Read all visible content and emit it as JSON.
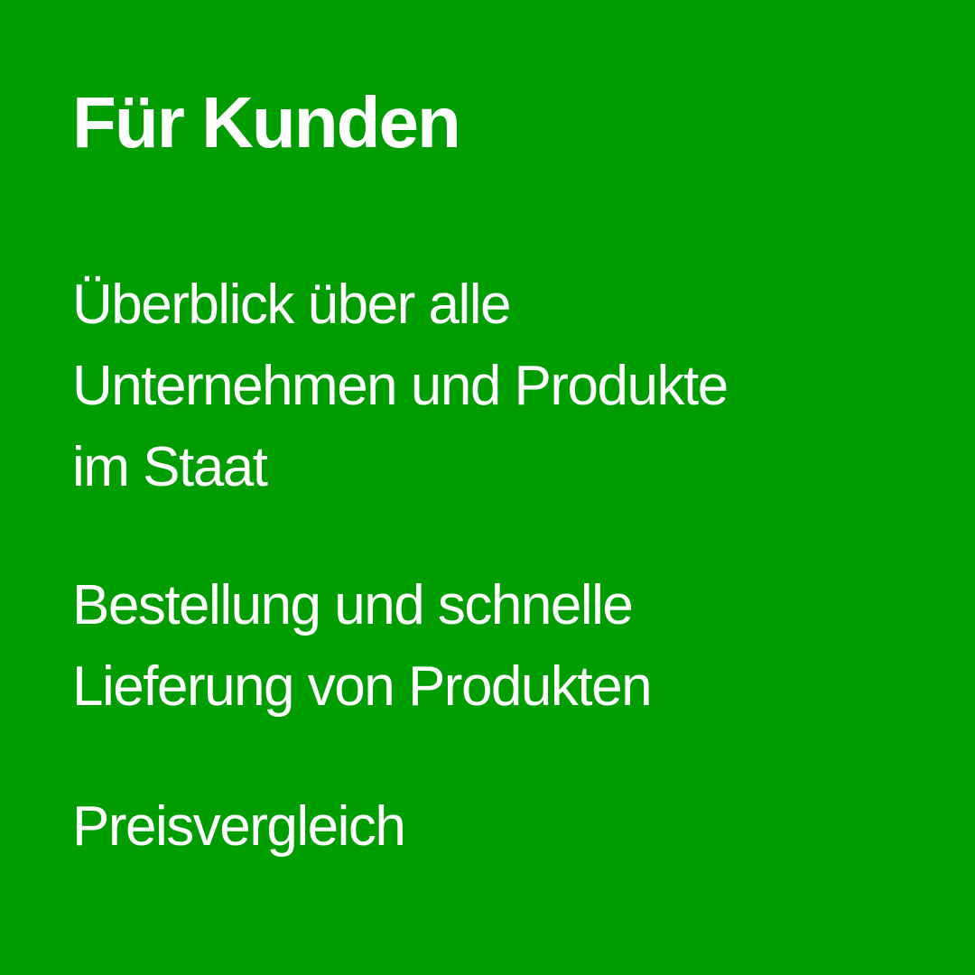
{
  "colors": {
    "background": "#009d00",
    "text": "#ffffff"
  },
  "title": "Für Kunden",
  "features": [
    {
      "lines": [
        "Überblick über alle",
        "Unternehmen und Produkte",
        "im Staat"
      ]
    },
    {
      "lines": [
        "Bestellung und schnelle",
        "Lieferung von Produkten"
      ]
    },
    {
      "lines": [
        "Preisvergleich"
      ]
    }
  ]
}
